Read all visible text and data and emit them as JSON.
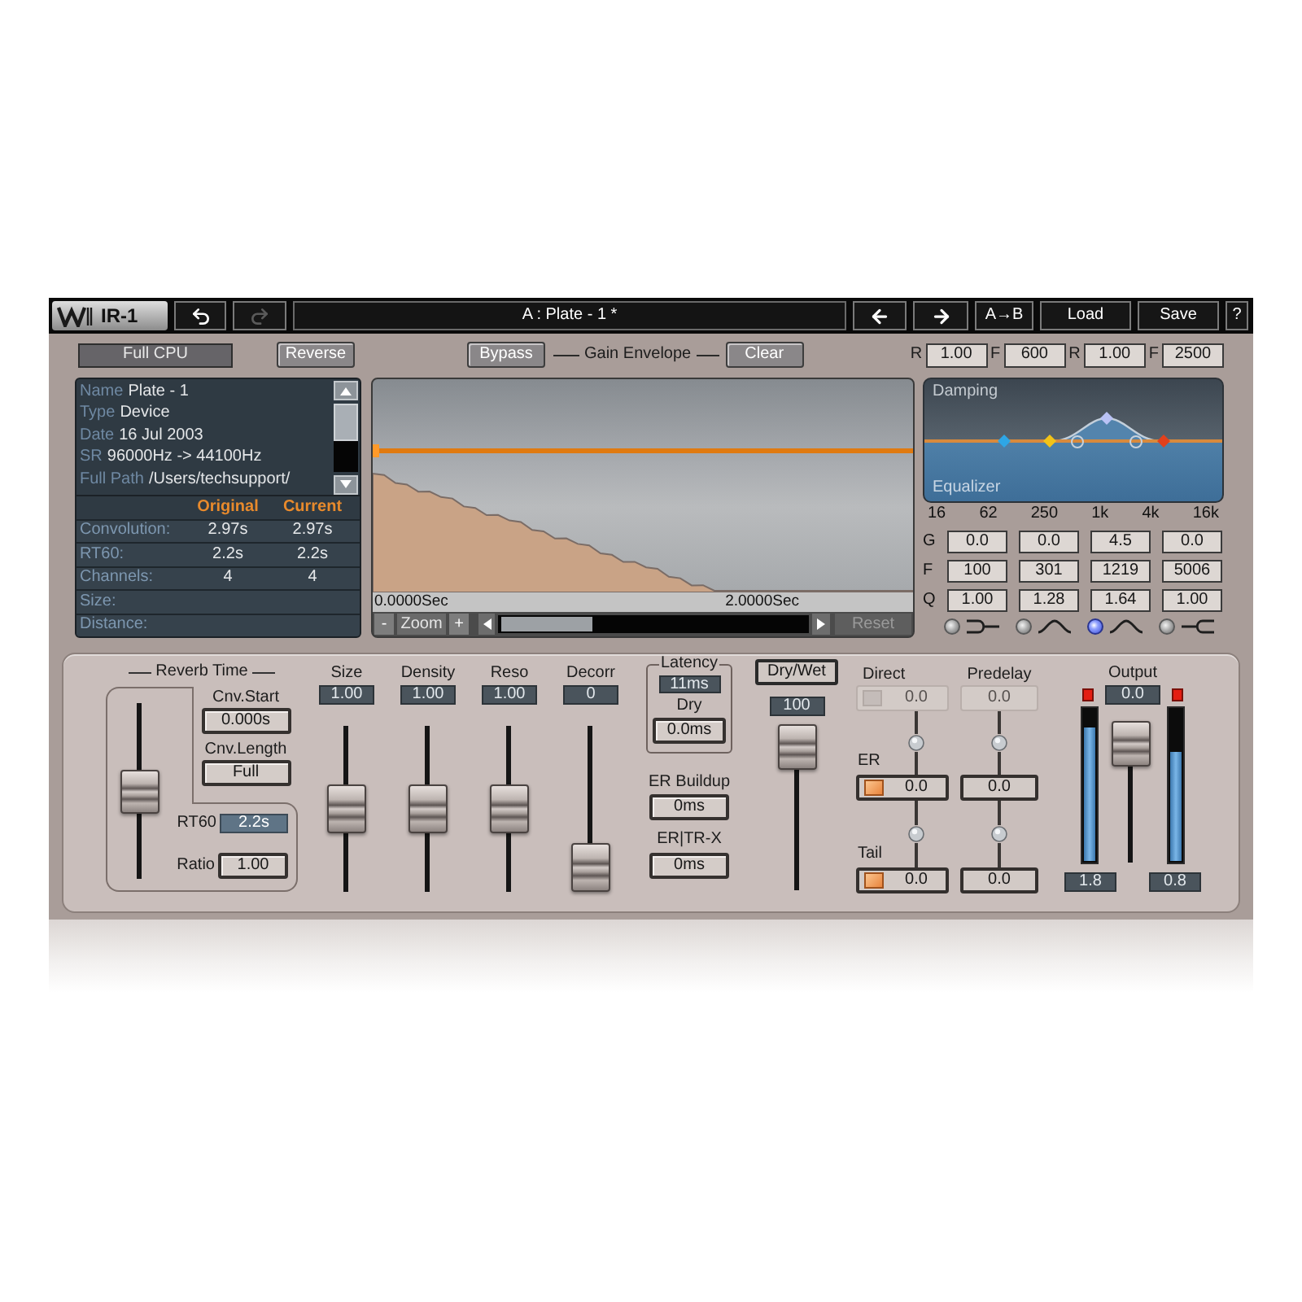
{
  "toolbar": {
    "logo": "IR-1",
    "undo": {
      "disabled": false
    },
    "redo": {
      "disabled": true
    },
    "preset": "A : Plate - 1 *",
    "buttons": [
      {
        "kind": "back"
      },
      {
        "kind": "forward"
      },
      {
        "kind": "text",
        "label": "A→B"
      },
      {
        "kind": "text",
        "label": "Load"
      },
      {
        "kind": "text",
        "label": "Save"
      },
      {
        "kind": "text",
        "label": "?"
      }
    ]
  },
  "options": {
    "full_cpu": "Full CPU",
    "reverse": "Reverse",
    "bypass": "Bypass",
    "gain_envelope": "Gain Envelope",
    "clear": "Clear",
    "damping": [
      {
        "label": "R",
        "value": "1.00"
      },
      {
        "label": "F",
        "value": "600"
      },
      {
        "label": "R",
        "value": "1.00"
      },
      {
        "label": "F",
        "value": "2500"
      }
    ]
  },
  "info": {
    "fields": [
      {
        "label": "Name",
        "value": "Plate - 1"
      },
      {
        "label": "Type",
        "value": "Device"
      },
      {
        "label": "Date",
        "value": "16 Jul 2003"
      },
      {
        "label": "SR",
        "value": "96000Hz -> 44100Hz"
      },
      {
        "label": "Full Path",
        "value": "/Users/techsupport/"
      }
    ],
    "columns": [
      "Original",
      "Current"
    ],
    "rows": [
      {
        "label": "Convolution:",
        "original": "2.97s",
        "current": "2.97s"
      },
      {
        "label": "RT60:",
        "original": "2.2s",
        "current": "2.2s"
      },
      {
        "label": "Channels:",
        "original": "4",
        "current": "4"
      },
      {
        "label": "Size:"
      },
      {
        "label": "Distance:"
      }
    ]
  },
  "envelope": {
    "start_time": "0.0000Sec",
    "end_time": "2.0000Sec",
    "zoom_out": "-",
    "zoom": "Zoom",
    "zoom_in": "+",
    "reset": {
      "label": "Reset",
      "disabled": true
    }
  },
  "eq": {
    "top_label": "Damping",
    "bottom_label": "Equalizer",
    "markers": [
      {
        "color": "#2ea6e6"
      },
      {
        "color": "#f2c318"
      },
      {
        "color": "#b9c2f5"
      },
      {
        "color": "#e2401c"
      }
    ],
    "scale": [
      "16",
      "62",
      "250",
      "1k",
      "4k",
      "16k"
    ],
    "row_labels": [
      "G",
      "F",
      "Q"
    ],
    "bands": [
      {
        "kind": "low_shelf",
        "gain": "0.0",
        "freq": "100",
        "q": "1.00",
        "selected": false
      },
      {
        "kind": "bell",
        "gain": "0.0",
        "freq": "301",
        "q": "1.28",
        "selected": false
      },
      {
        "kind": "bell",
        "gain": "4.5",
        "freq": "1219",
        "q": "1.64",
        "selected": true
      },
      {
        "kind": "high_shelf",
        "gain": "0.0",
        "freq": "5006",
        "q": "1.00",
        "selected": false
      }
    ]
  },
  "reverb_time": {
    "title": "Reverb Time",
    "level": 0.5,
    "cnv_start": {
      "label": "Cnv.Start",
      "value": "0.000s"
    },
    "cnv_length": {
      "label": "Cnv.Length",
      "value": "Full"
    },
    "rt60": {
      "label": "RT60",
      "value": "2.2s"
    },
    "ratio": {
      "label": "Ratio",
      "value": "1.00"
    }
  },
  "faders": [
    {
      "label": "Size",
      "value": "1.00",
      "level": 0.5
    },
    {
      "label": "Density",
      "value": "1.00",
      "level": 0.5
    },
    {
      "label": "Reso",
      "value": "1.00",
      "level": 0.5
    },
    {
      "label": "Decorr",
      "value": "0",
      "level": 0
    }
  ],
  "latency": {
    "title": "Latency",
    "value": "11ms",
    "dry_label": "Dry",
    "dry_value": "0.0ms"
  },
  "er_buildup": {
    "label": "ER Buildup",
    "value": "0ms"
  },
  "er_tr_x": {
    "label": "ER|TR-X",
    "value": "0ms"
  },
  "dry_wet": {
    "label": "Dry/Wet",
    "value": "100",
    "level": 1
  },
  "mix": {
    "predelay_header": "Predelay",
    "rows": [
      {
        "label": "Direct",
        "on": false,
        "gain": "0.0",
        "predelay": "0.0"
      },
      {
        "label": "ER",
        "on": true,
        "gain": "0.0",
        "predelay": "0.0"
      },
      {
        "label": "Tail",
        "on": true,
        "gain": "0.0",
        "predelay": "0.0"
      }
    ]
  },
  "output": {
    "label": "Output",
    "value": "0.0",
    "level": 1,
    "meters": [
      {
        "clip": true,
        "level": 0.88,
        "reading": "1.8"
      },
      {
        "clip": true,
        "level": 0.72,
        "reading": "0.8"
      }
    ]
  }
}
